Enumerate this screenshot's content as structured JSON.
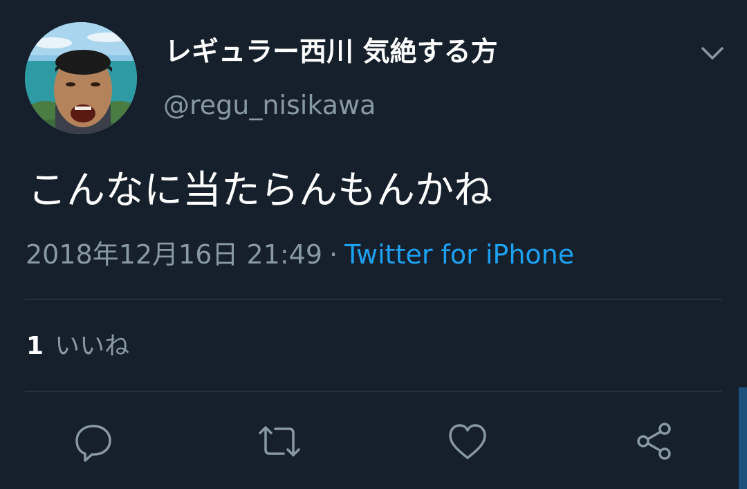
{
  "tweet": {
    "author": {
      "display_name": "レギュラー西川 気絶する方",
      "handle": "@regu_nisikawa"
    },
    "text": "こんなに当たらんもんかね",
    "timestamp": "2018年12月16日 21:49",
    "separator": "·",
    "source": "Twitter for iPhone",
    "likes": {
      "count": "1",
      "label": "いいね"
    }
  },
  "icons": {
    "menu": "chevron-down-icon",
    "reply": "reply-icon",
    "retweet": "retweet-icon",
    "like": "heart-icon",
    "share": "share-icon"
  },
  "colors": {
    "background": "#16202c",
    "text": "#ffffff",
    "muted": "#8899a6",
    "link": "#1da1f2",
    "divider": "#38444d"
  }
}
